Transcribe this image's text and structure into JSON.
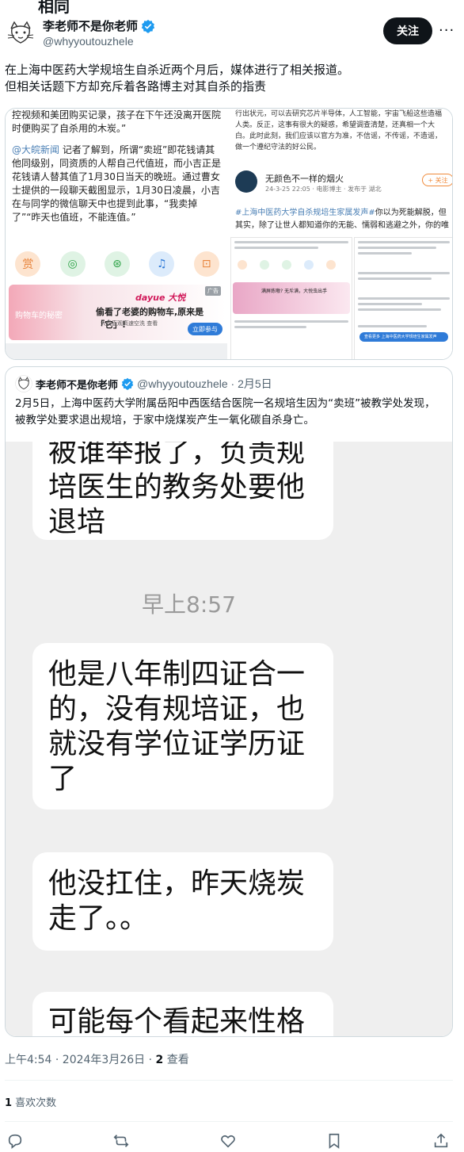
{
  "top_cut_text": "相同",
  "author": {
    "name": "李老师不是你老师",
    "handle": "@whyyoutouzhele",
    "follow_label": "关注",
    "more_label": "···"
  },
  "tweet": {
    "line1": "在上海中医药大学规培生自杀近两个月后，媒体进行了相关报道。",
    "line2": "但相关话题下方却充斥着各路博主对其自杀的指责"
  },
  "media_left": {
    "text_top": "控视频和美团购买记录，孩子在下午还没离开医院时便购买了自杀用的木炭。”",
    "link": "@大皖新闻",
    "text_body": " 记者了解到，所谓“卖班”即花钱请其他同级别，同资质的人帮自己代值班，而小吉正是花钱请人替其值了1月30日当天的晚班。通过曹女士提供的一段聊天截图显示，1月30日凌晨，小吉在与同学的微信聊天中也提到此事，“我卖掉了”“昨天也值班，不能连值。”",
    "icons": [
      "赏",
      "◎",
      "⊛",
      "♫",
      "⊡"
    ],
    "ad_brand": "dayue 大悦",
    "ad_line": "偷看了老婆的购物车,原来是「它」!",
    "ad_sub": "大悦直观高速空洗 查看",
    "ad_cta": "立即参与",
    "ad_tag": "广告",
    "ad_cart": "购物车的秘密"
  },
  "media_right": {
    "text_top": "行出状元，可以去研究芯片半导体，人工智能，宇宙飞船这些造福人类。反正，这事有很大的疑惑，希望调查清楚，还真相一个大白。此时此刻，我们应该以官方为准，不信谣，不传谣，不造谣，做一个遵纪守法的好公民。",
    "uname": "无颜色不一样的烟火",
    "meta": "24-3-25 22:05 · 电影博主 · 发布于 湖北",
    "follow": "+ 关注",
    "hashtag": "#上海中医药大学自杀规培生家属发声#",
    "body": "你以为死能解脱，但其实，除了让世人都知道你的无能、懦弱和逃避之外，你的唯",
    "mini_ad_text": "满屏炼嗷? 无斥满，大悦虫出手",
    "mini_blue": "查看更多 上海中医药大学规培生家属发声"
  },
  "quote": {
    "name": "李老师不是你老师",
    "handle_date": "@whyyoutouzhele · 2月5日",
    "text": "2月5日，上海中医药大学附属岳阳中西医结合医院一名规培生因为“卖班”被教学处发现，被教学处要求退出规培，于家中烧煤炭产生一氧化碳自杀身亡。"
  },
  "chat": {
    "bubble1": "被谁举报了，负责规培医生的教务处要他退培",
    "time": "早上8:57",
    "bubble2": "他是八年制四证合一的，没有规培证，也就没有学位证学历证了",
    "bubble3": "他没扛住，昨天烧炭走了。。",
    "bubble4": "可能每个看起来性格"
  },
  "meta": {
    "time": "上午4:54 · 2024年3月26日 · ",
    "views_count": "2",
    "views_label": " 查看"
  },
  "likes": {
    "count": "1",
    "label": " 喜欢次数"
  },
  "colors": {
    "accent": "#1d9bf0",
    "text": "#0f1419",
    "muted": "#536471",
    "border": "#cfd9de"
  }
}
